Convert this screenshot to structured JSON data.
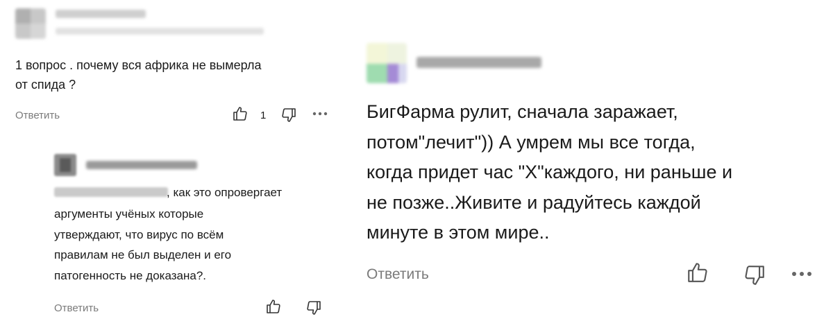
{
  "comments": [
    {
      "text": "1 вопрос . почему вся африка не вымерла\nот спида ?",
      "reply_label": "Ответить",
      "likes": "1"
    },
    {
      "mention_suffix": ", как это опровергает",
      "text": "аргументы учёных которые\nутверждают, что вирус по всём\nправилам не был выделен и его\nпатогенность не доказана?.",
      "reply_label": "Ответить"
    },
    {
      "text": "БигФарма рулит, сначала заражает,\nпотом\"лечит\")) А умрем мы все тогда,\nкогда придет час \"Х\"каждого, ни раньше и\nне позже..Живите и радуйтесь каждой\nминуте в этом мире..",
      "reply_label": "Ответить"
    }
  ],
  "icons": {
    "like": "thumbs-up-icon",
    "dislike": "thumbs-down-icon",
    "more": "more-dots-icon"
  },
  "colors": {
    "text": "#1a1a1a",
    "muted": "#7a7a7a",
    "blur": "#d9d9d9"
  }
}
